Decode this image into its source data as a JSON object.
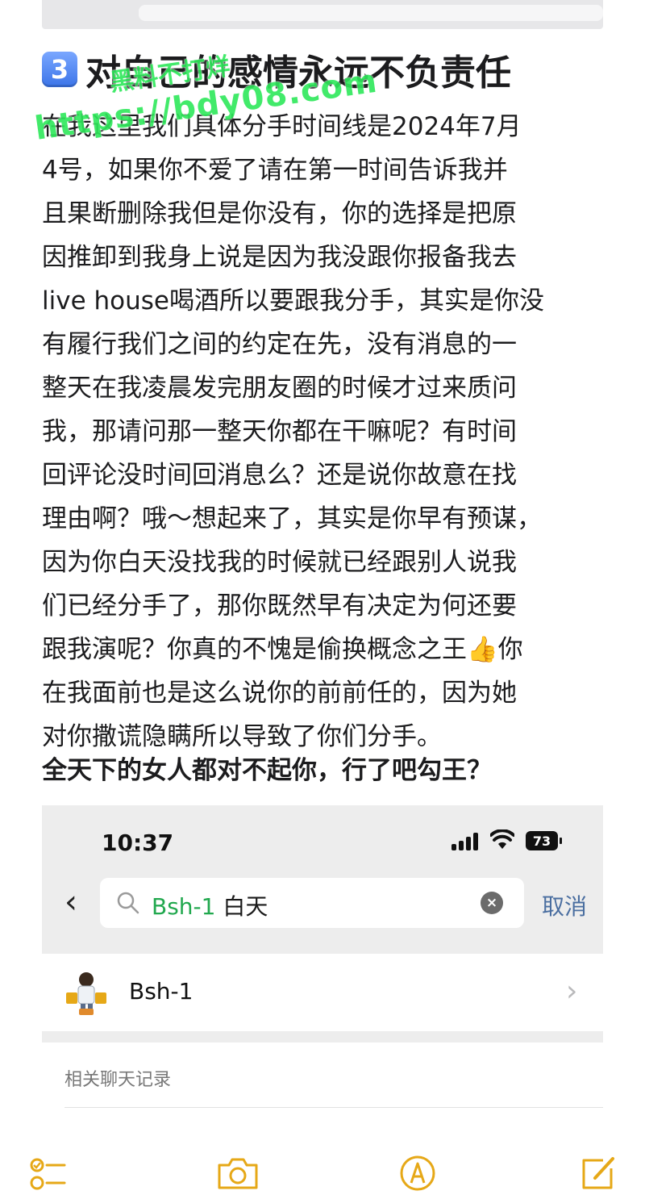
{
  "note": {
    "heading_number": "3",
    "heading": "对自己的感情永远不负责任",
    "watermark": {
      "line1": "黑料不打烊",
      "line2": "https://bdy08.com"
    },
    "body_lines": [
      "在我这里我们具体分手时间线是2024年7月",
      "4号，如果你不爱了请在第一时间告诉我并",
      "且果断删除我但是你没有，你的选择是把原",
      "因推卸到我身上说是因为我没跟你报备我去",
      "live house喝酒所以要跟我分手，其实是你没",
      "有履行我们之间的约定在先，没有消息的一",
      "整天在我凌晨发完朋友圈的时候才过来质问",
      "我，那请问那一整天你都在干嘛呢？有时间",
      "回评论没时间回消息么？还是说你故意在找",
      "理由啊？哦～想起来了，其实是你早有预谋，",
      "因为你白天没找我的时候就已经跟别人说我",
      "们已经分手了，那你既然早有决定为何还要",
      "跟我演呢？你真的不愧是偷换概念之王👍你",
      "在我面前也是这么说你的前前任的，因为她",
      "对你撒谎隐瞒所以导致了你们分手。"
    ],
    "closing_line": "全天下的女人都对不起你，行了吧勾王？"
  },
  "screenshot": {
    "time": "10:37",
    "battery": "73",
    "search": {
      "highlight": "Bsh-1",
      "rest": " 白天",
      "cancel_label": "取消"
    },
    "contact": {
      "name": "Bsh-1"
    },
    "records_label": "相关聊天记录"
  },
  "icons": {
    "heading_keycap": "keycap-3-icon",
    "back": "chevron-left-icon",
    "search": "search-icon",
    "clear": "clear-icon",
    "contact_chevron": "chevron-right-icon",
    "toolbar": [
      "checklist-icon",
      "camera-icon",
      "markup-icon",
      "compose-icon"
    ]
  },
  "colors": {
    "accent_yellow": "#e6a817",
    "search_highlight": "#21a84e",
    "cancel_blue": "#4a6ea0",
    "watermark_green": "#2ee85a"
  }
}
